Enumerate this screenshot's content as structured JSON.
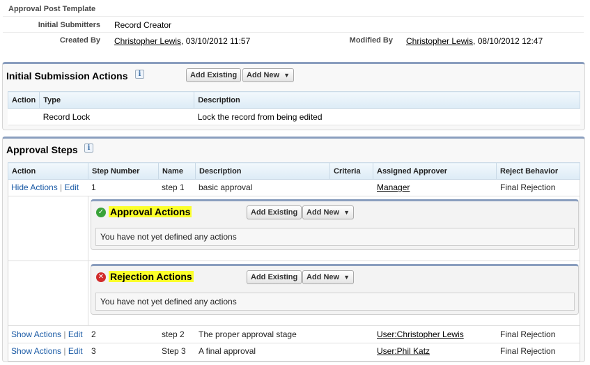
{
  "details": {
    "template_value": "Approval Post Template",
    "initial_submitters_label": "Initial Submitters",
    "initial_submitters_value": "Record Creator",
    "created_by_label": "Created By",
    "created_by_user": "Christopher Lewis",
    "created_by_date": ", 03/10/2012 11:57",
    "modified_by_label": "Modified By",
    "modified_by_user": "Christopher Lewis",
    "modified_by_date": ", 08/10/2012 12:47"
  },
  "initial_submission": {
    "title": "Initial Submission Actions",
    "info": "i",
    "add_existing": "Add Existing",
    "add_new": "Add New",
    "columns": [
      "Action",
      "Type",
      "Description"
    ],
    "rows": [
      {
        "action": "",
        "type": "Record Lock",
        "description": "Lock the record from being edited"
      }
    ]
  },
  "approval_steps": {
    "title": "Approval Steps",
    "info": "i",
    "columns": [
      "Action",
      "Step Number",
      "Name",
      "Description",
      "Criteria",
      "Assigned Approver",
      "Reject Behavior"
    ],
    "steps": [
      {
        "toggle": "Hide Actions",
        "edit": "Edit",
        "sep": "|",
        "number": "1",
        "name": "step 1",
        "description": "basic approval",
        "criteria": "",
        "approver": "Manager",
        "reject": "Final Rejection"
      },
      {
        "toggle": "Show Actions",
        "edit": "Edit",
        "sep": "|",
        "number": "2",
        "name": "step 2",
        "description": "The proper approval stage",
        "criteria": "",
        "approver": "User:Christopher Lewis",
        "reject": "Final Rejection"
      },
      {
        "toggle": "Show Actions",
        "edit": "Edit",
        "sep": "|",
        "number": "3",
        "name": "Step 3",
        "description": "A final approval",
        "criteria": "",
        "approver": "User:Phil Katz",
        "reject": "Final Rejection"
      }
    ],
    "approval_actions": {
      "title": "Approval Actions",
      "add_existing": "Add Existing",
      "add_new": "Add New",
      "empty": "You have not yet defined any actions"
    },
    "rejection_actions": {
      "title": "Rejection Actions",
      "add_existing": "Add Existing",
      "add_new": "Add New",
      "empty": "You have not yet defined any actions"
    }
  },
  "colors": {
    "accent": "#8a9ebe",
    "highlight": "#fbff2a",
    "approve": "#3aa33a",
    "reject": "#d12b2b",
    "link": "#1a5aa5"
  },
  "icons": {
    "approve": "check-circle-icon",
    "reject": "x-circle-icon",
    "caret": "caret-down-icon",
    "info": "info-icon"
  }
}
